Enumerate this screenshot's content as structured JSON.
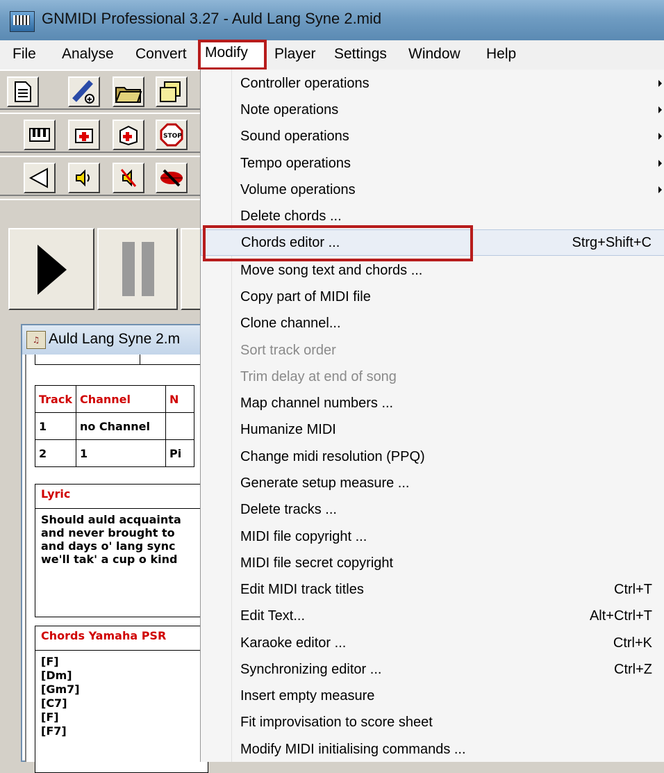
{
  "window": {
    "title": "GNMIDI Professional 3.27 - Auld Lang Syne 2.mid",
    "app_icon": "gnmidi-app-icon"
  },
  "menubar": {
    "items": [
      "File",
      "Analyse",
      "Convert",
      "Modify",
      "Player",
      "Settings",
      "Window",
      "Help"
    ],
    "active": "Modify",
    "highlight_color": "#b71c1c"
  },
  "toolbar": {
    "row1": [
      "new-document-icon",
      "midi-wand-icon",
      "open-folder-icon",
      "open-multiple-icon"
    ],
    "row2": [
      "piano-keys-icon",
      "first-aid-icon",
      "repair-box-icon",
      "stop-sign-icon"
    ],
    "row3": [
      "speaker-cone-icon",
      "speaker-volume-icon",
      "speaker-muted-icon",
      "lips-muted-icon"
    ],
    "transport": [
      "play-icon",
      "pause-icon"
    ]
  },
  "document": {
    "title": "Auld Lang Syne 2.m",
    "icon": "midi-file-icon",
    "tracks": {
      "headers": [
        "Track",
        "Channel",
        "N"
      ],
      "rows": [
        [
          "1",
          "no Channel",
          ""
        ],
        [
          "2",
          "1",
          "Pi"
        ]
      ]
    },
    "lyric": {
      "heading": "Lyric",
      "lines": "Should auld acquainta\nand never brought to\nand days o' lang sync\nwe'll tak' a cup o kind"
    },
    "chords": {
      "heading": "Chords Yamaha PSR",
      "lines": "[F]\n[Dm]\n[Gm7]\n[C7]\n[F]\n[F7]"
    }
  },
  "modify_menu": {
    "items": [
      {
        "label": "Controller operations",
        "submenu": true
      },
      {
        "label": "Note operations",
        "submenu": true
      },
      {
        "label": "Sound operations",
        "submenu": true
      },
      {
        "label": "Tempo operations",
        "submenu": true
      },
      {
        "label": "Volume operations",
        "submenu": true
      },
      {
        "label": "Delete chords ..."
      },
      {
        "label": "Chords editor ...",
        "shortcut": "Strg+Shift+C",
        "highlighted": true
      },
      {
        "label": "Move song text and chords ..."
      },
      {
        "label": "Copy part of MIDI file"
      },
      {
        "label": "Clone channel..."
      },
      {
        "label": "Sort track order",
        "disabled": true
      },
      {
        "label": "Trim delay at end of song",
        "disabled": true
      },
      {
        "label": "Map channel numbers ..."
      },
      {
        "label": "Humanize MIDI"
      },
      {
        "label": "Change midi resolution (PPQ)"
      },
      {
        "label": "Generate setup measure ..."
      },
      {
        "label": "Delete tracks ..."
      },
      {
        "label": "MIDI file copyright ..."
      },
      {
        "label": "MIDI file secret copyright"
      },
      {
        "label": "Edit MIDI track titles",
        "shortcut": "Ctrl+T"
      },
      {
        "label": "Edit Text...",
        "shortcut": "Alt+Ctrl+T"
      },
      {
        "label": "Karaoke editor ...",
        "shortcut": "Ctrl+K"
      },
      {
        "label": "Synchronizing editor ...",
        "shortcut": "Ctrl+Z"
      },
      {
        "label": "Insert empty measure"
      },
      {
        "label": "Fit improvisation to score sheet"
      },
      {
        "label": "Modify MIDI initialising commands ..."
      }
    ]
  }
}
